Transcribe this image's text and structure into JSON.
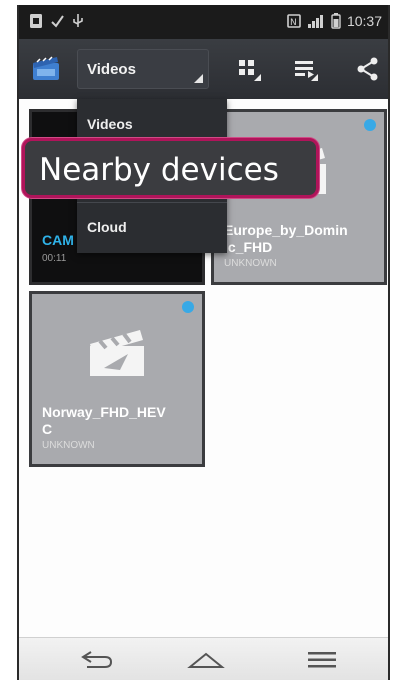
{
  "status_bar": {
    "time": "10:37"
  },
  "action_bar": {
    "spinner_label": "Videos",
    "icons": [
      "gallery-app-icon",
      "grid-view-icon",
      "playlist-icon",
      "share-icon"
    ]
  },
  "dropdown": {
    "items": [
      {
        "label": "Videos"
      },
      {
        "label": ""
      },
      {
        "label": "Cloud"
      }
    ]
  },
  "callout": {
    "label": "Nearby devices"
  },
  "tiles": [
    {
      "title": "CAM",
      "subtitle": "00:11",
      "selected": false
    },
    {
      "title": "Europe_by_Domin\nic_FHD",
      "subtitle": "UNKNOWN",
      "selected": true
    },
    {
      "title": "Norway_FHD_HEV\nC",
      "subtitle": "UNKNOWN",
      "selected": true
    }
  ],
  "nav_bar": {
    "icons": [
      "back-icon",
      "home-icon",
      "menu-icon"
    ]
  },
  "colors": {
    "accent": "#38a9e6",
    "callout_border": "#b0145a",
    "action_bar": "#2f3136"
  }
}
